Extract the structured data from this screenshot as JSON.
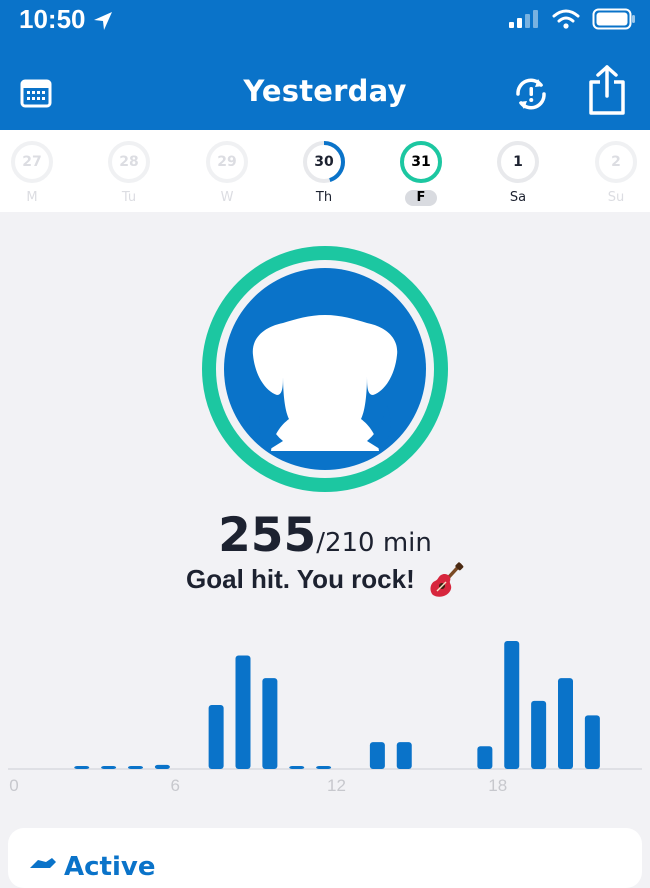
{
  "status": {
    "time": "10:50"
  },
  "header": {
    "title": "Yesterday",
    "calendar_icon": "calendar-icon",
    "sync_icon": "sync-alert-icon",
    "share_icon": "share-icon"
  },
  "days": [
    {
      "num": "27",
      "label": "M",
      "state": "faded",
      "progress": 0
    },
    {
      "num": "28",
      "label": "Tu",
      "state": "faded",
      "progress": 0
    },
    {
      "num": "29",
      "label": "W",
      "state": "faded",
      "progress": 0
    },
    {
      "num": "30",
      "label": "Th",
      "state": "dark",
      "progress": 0.45
    },
    {
      "num": "31",
      "label": "F",
      "state": "selected",
      "progress": 1
    },
    {
      "num": "1",
      "label": "Sa",
      "state": "dark",
      "progress": 0
    },
    {
      "num": "2",
      "label": "Su",
      "state": "faded",
      "progress": 0
    }
  ],
  "summary": {
    "minutes": "255",
    "goal_text": "/210 min",
    "message": "Goal hit. You rock!",
    "emoji_icon": "guitar-icon"
  },
  "chart_data": {
    "type": "bar",
    "x": [
      2,
      3,
      4,
      5,
      7,
      8,
      9,
      10,
      11,
      13,
      14,
      17,
      18,
      19,
      20,
      21
    ],
    "values": [
      1,
      1,
      1,
      2,
      31,
      55,
      44,
      1,
      1,
      13,
      13,
      11,
      62,
      33,
      44,
      26
    ],
    "xticks": [
      "0",
      "6",
      "12",
      "18"
    ],
    "xlim": [
      0,
      24
    ],
    "ylim": [
      0,
      62
    ],
    "color": "#0a73c9"
  },
  "card": {
    "title": "Active"
  },
  "colors": {
    "brand": "#0a73c9",
    "teal": "#1cc7a1"
  }
}
